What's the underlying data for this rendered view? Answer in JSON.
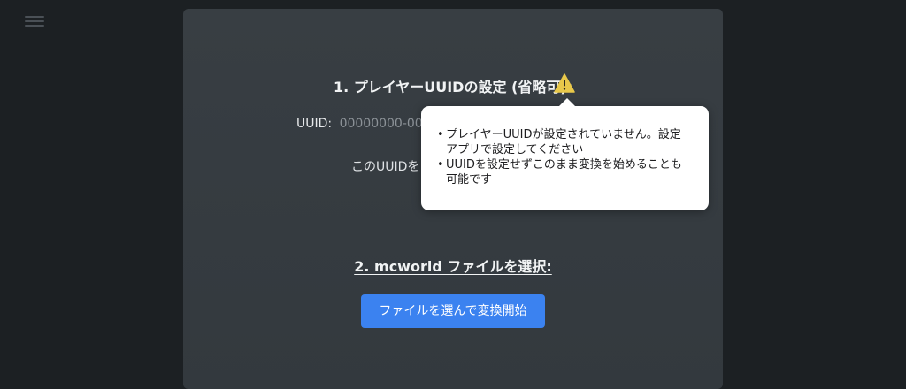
{
  "menu": {
    "icon": "hamburger-menu-icon"
  },
  "section1": {
    "title": "1. プレイヤーUUIDの設定 (省略可):",
    "warning_icon": "warning-triangle-icon",
    "uuid_label": "UUID:",
    "uuid_value": "00000000-000",
    "note": "このUUIDを"
  },
  "popover": {
    "items": [
      "プレイヤーUUIDが設定されていません。設定アプリで設定してください",
      "UUIDを設定せずこのまま変換を始めることも可能です"
    ]
  },
  "section2": {
    "title": "2. mcworld ファイルを選択:",
    "button_label": "ファイルを選んで変換開始"
  },
  "colors": {
    "background": "#1c2023",
    "card": "#353b40",
    "accent": "#3b82f0",
    "warning": "#e8c84a"
  }
}
